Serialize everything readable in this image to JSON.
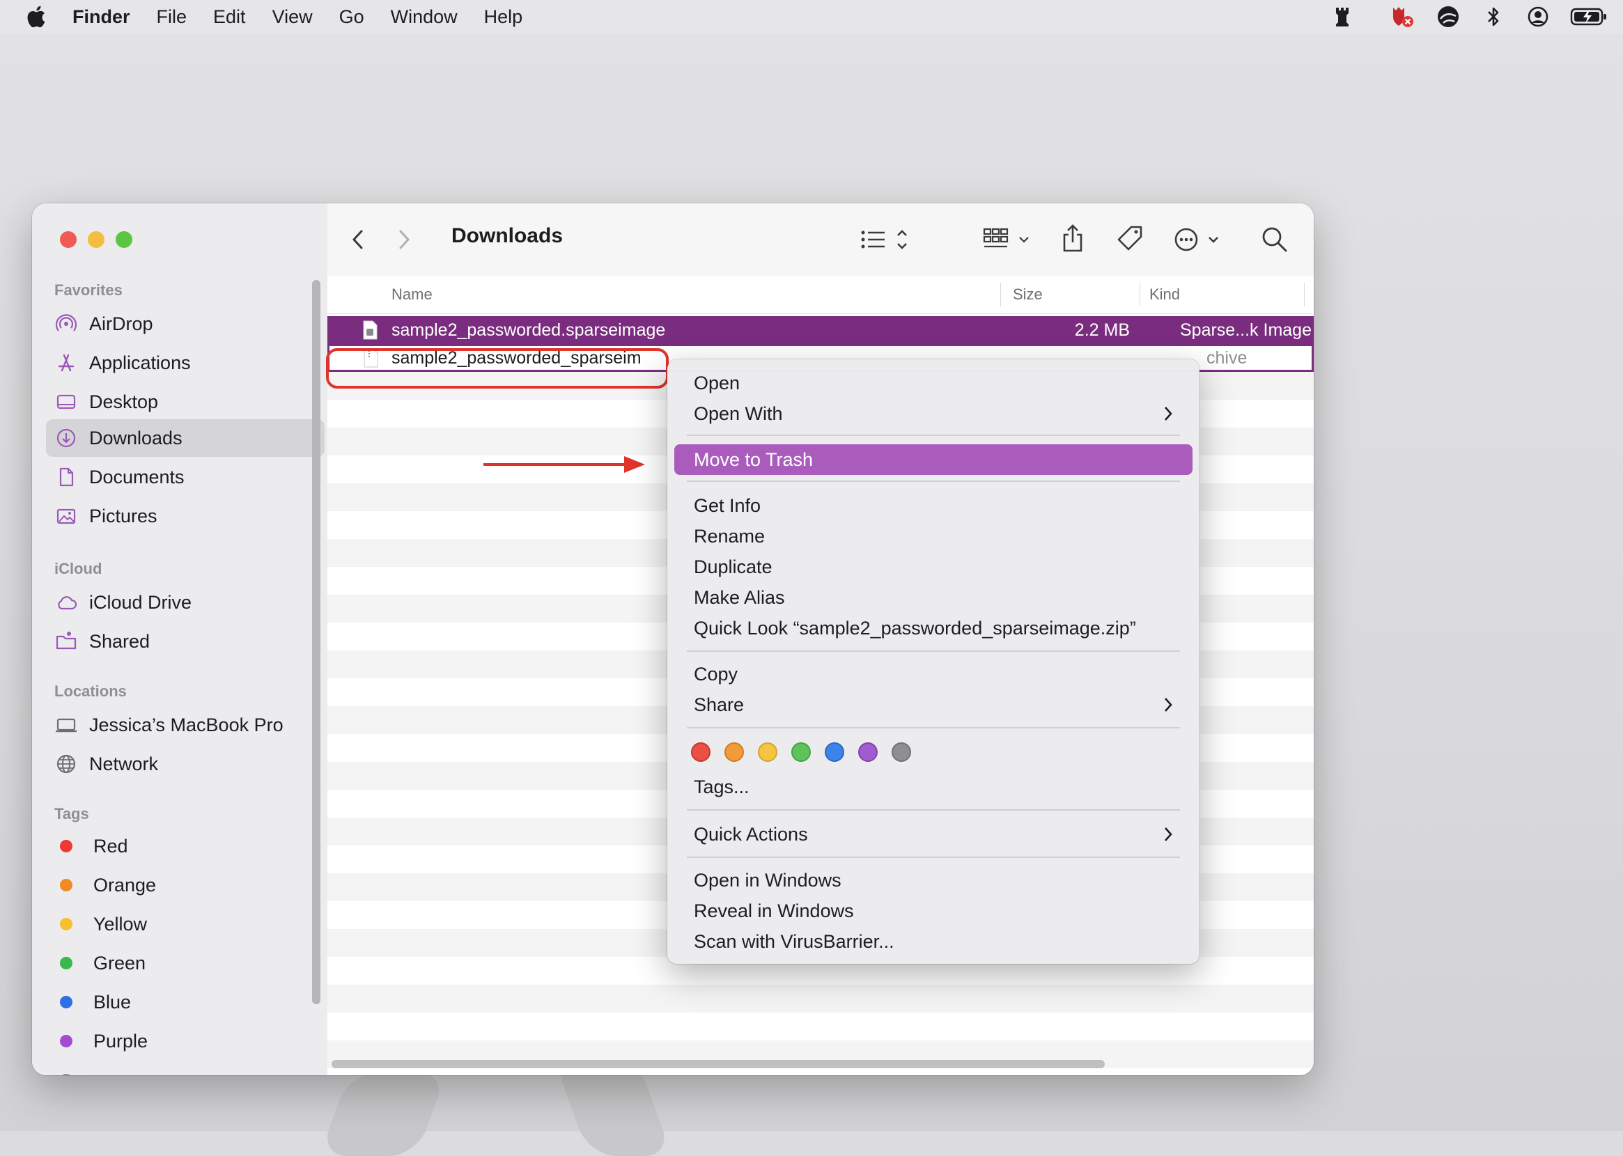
{
  "menubar": {
    "app_name": "Finder",
    "items": [
      "File",
      "Edit",
      "View",
      "Go",
      "Window",
      "Help"
    ],
    "status_icons": [
      "rook-icon",
      "antivirus-icon",
      "vpn-icon",
      "bluetooth-icon",
      "user-account-icon",
      "battery-charging-icon"
    ]
  },
  "window": {
    "title": "Downloads",
    "sidebar": {
      "favorites_label": "Favorites",
      "favorites": [
        {
          "label": "AirDrop",
          "icon": "airdrop-icon"
        },
        {
          "label": "Applications",
          "icon": "applications-icon"
        },
        {
          "label": "Desktop",
          "icon": "desktop-icon"
        },
        {
          "label": "Downloads",
          "icon": "downloads-icon"
        },
        {
          "label": "Documents",
          "icon": "document-icon"
        },
        {
          "label": "Pictures",
          "icon": "pictures-icon"
        }
      ],
      "icloud_label": "iCloud",
      "icloud": [
        {
          "label": "iCloud Drive",
          "icon": "cloud-icon"
        },
        {
          "label": "Shared",
          "icon": "shared-folder-icon"
        }
      ],
      "locations_label": "Locations",
      "locations": [
        {
          "label": "Jessica’s MacBook Pro",
          "icon": "laptop-icon"
        },
        {
          "label": "Network",
          "icon": "globe-icon"
        }
      ],
      "tags_label": "Tags",
      "tags": [
        {
          "label": "Red",
          "color": "#ec3b32"
        },
        {
          "label": "Orange",
          "color": "#f08a24"
        },
        {
          "label": "Yellow",
          "color": "#f6c02f"
        },
        {
          "label": "Green",
          "color": "#3cb74a"
        },
        {
          "label": "Blue",
          "color": "#2f6fe4"
        },
        {
          "label": "Purple",
          "color": "#a54bd3"
        }
      ]
    },
    "columns": {
      "name": "Name",
      "size": "Size",
      "kind": "Kind"
    },
    "files": [
      {
        "name": "sample2_passworded.sparseimage",
        "size": "2.2 MB",
        "kind": "Sparse...k Image",
        "state": "selected"
      },
      {
        "name": "sample2_passworded_sparseim",
        "size": "",
        "kind": "chive",
        "state": "focused"
      }
    ]
  },
  "context_menu": {
    "open": "Open",
    "open_with": "Open With",
    "move_to_trash": "Move to Trash",
    "get_info": "Get Info",
    "rename": "Rename",
    "duplicate": "Duplicate",
    "make_alias": "Make Alias",
    "quick_look": "Quick Look “sample2_passworded_sparseimage.zip”",
    "copy": "Copy",
    "share": "Share",
    "tag_colors": [
      "#ec4f45",
      "#f29b3a",
      "#f5c443",
      "#5fc35a",
      "#3d84ea",
      "#a35bd0",
      "#8e8e93"
    ],
    "tags": "Tags...",
    "quick_actions": "Quick Actions",
    "open_in_windows": "Open in Windows",
    "reveal_in_windows": "Reveal in Windows",
    "scan": "Scan with VirusBarrier..."
  },
  "accent": {
    "selection": "#7a2d7f",
    "menu_highlight": "#a95cbb",
    "annotation": "#e0332b"
  }
}
